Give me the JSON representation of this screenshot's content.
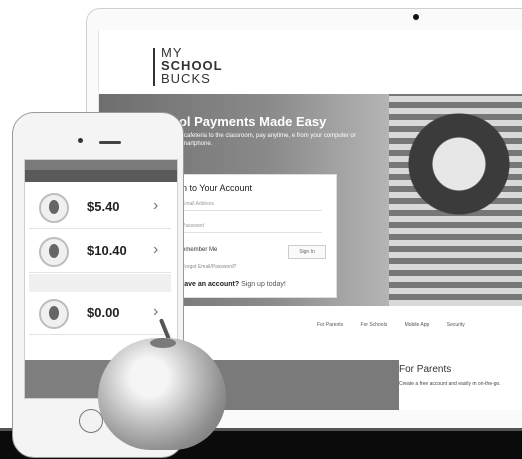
{
  "website": {
    "logo_lines": [
      "MY",
      "SCHOOL",
      "BUCKS"
    ],
    "hero_title": "ool Payments Made Easy",
    "hero_subtitle": "e cafeteria to the classroom, pay anytime, e from your computer or smartphone.",
    "signin": {
      "title": "in to Your Account",
      "email_placeholder": "Email Address",
      "password_placeholder": "Password",
      "remember_me": "emember Me",
      "signin_button": "Sign In",
      "forgot_link": "Forgot Email/Password?",
      "no_account": "have an account?",
      "signup_link": "Sign up today!"
    },
    "footer_links": [
      "For Parents",
      "For Schools",
      "Mobile App",
      "Security"
    ],
    "for_parents_title": "For Parents",
    "for_parents_text": "Create a free account and easily m on-the-go."
  },
  "phone": {
    "children": [
      {
        "amount": "$5.40"
      },
      {
        "amount": "$10.40"
      },
      {
        "amount": "$0.00"
      }
    ]
  }
}
